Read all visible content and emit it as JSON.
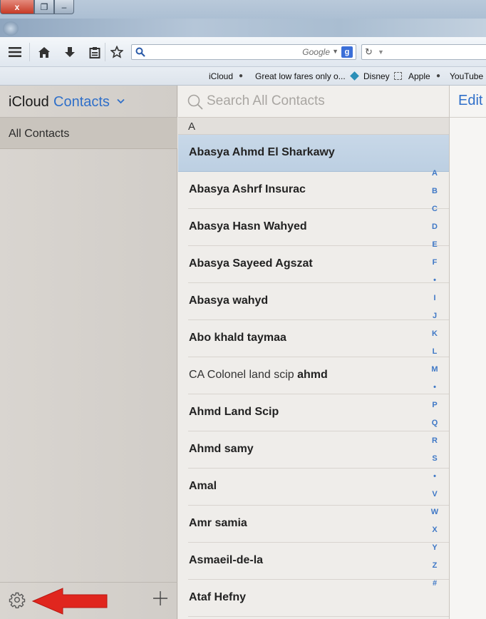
{
  "window": {
    "close_label": "x",
    "restore_label": "❐",
    "min_label": "–"
  },
  "browser": {
    "url_engine": "Google",
    "engine_logo": "g",
    "bookmarks": [
      {
        "label": "iCloud",
        "icon": "apple-icon"
      },
      {
        "label": "Great low fares only o...",
        "icon": "diamond-icon"
      },
      {
        "label": "Disney",
        "icon": "square-icon"
      },
      {
        "label": "Apple",
        "icon": "apple-icon"
      },
      {
        "label": "YouTube",
        "icon": ""
      }
    ]
  },
  "sidebar": {
    "brand": "iCloud",
    "app_name": "Contacts",
    "groups": [
      {
        "label": "All Contacts"
      }
    ]
  },
  "list": {
    "search_placeholder": "Search All Contacts",
    "section_letter": "A",
    "contacts": [
      {
        "first": "Abasya Ahmd El Sharkawy",
        "last": "",
        "selected": true
      },
      {
        "first": "Abasya Ashrf Insurac",
        "last": ""
      },
      {
        "first": "Abasya Hasn Wahyed",
        "last": ""
      },
      {
        "first": "Abasya Sayeed Agszat",
        "last": ""
      },
      {
        "first": "Abasya wahyd",
        "last": ""
      },
      {
        "first": "Abo khald taymaa",
        "last": ""
      },
      {
        "first": "CA Colonel land scip ",
        "last": "ahmd",
        "first_light": true
      },
      {
        "first": "Ahmd Land Scip",
        "last": ""
      },
      {
        "first": "Ahmd samy",
        "last": ""
      },
      {
        "first": "Amal",
        "last": ""
      },
      {
        "first": "Amr samia",
        "last": ""
      },
      {
        "first": "Asmaeil-de-la",
        "last": ""
      },
      {
        "first": "Ataf Hefny",
        "last": ""
      }
    ],
    "index": [
      "A",
      "B",
      "C",
      "D",
      "E",
      "F",
      "•",
      "I",
      "J",
      "K",
      "L",
      "M",
      "•",
      "P",
      "Q",
      "R",
      "S",
      "•",
      "V",
      "W",
      "X",
      "Y",
      "Z",
      "#"
    ]
  },
  "detail": {
    "edit_label": "Edit"
  },
  "colors": {
    "accent": "#2f6fc9",
    "selected_row": "#c2d4e6",
    "arrow": "#e0261e"
  }
}
